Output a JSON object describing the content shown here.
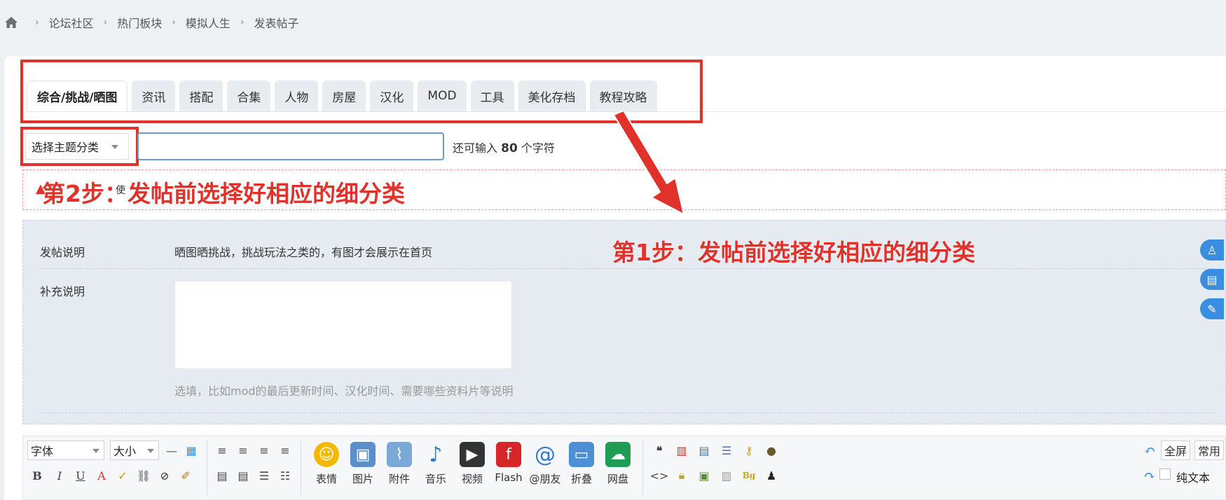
{
  "breadcrumb": {
    "items": [
      "论坛社区",
      "热门板块",
      "模拟人生",
      "发表帖子"
    ]
  },
  "tabs": [
    {
      "label": "综合/挑战/晒图",
      "active": true
    },
    {
      "label": "资讯"
    },
    {
      "label": "搭配"
    },
    {
      "label": "合集"
    },
    {
      "label": "人物"
    },
    {
      "label": "房屋"
    },
    {
      "label": "汉化"
    },
    {
      "label": "MOD"
    },
    {
      "label": "工具"
    },
    {
      "label": "美化存档"
    },
    {
      "label": "教程攻略"
    }
  ],
  "topic": {
    "type_select": "选择主题分类",
    "title_value": "",
    "char_hint_prefix": "还可输入",
    "char_count": "80",
    "char_hint_suffix": "个字符"
  },
  "notice": {
    "small_text": "使"
  },
  "annotations": {
    "step2": "第2步：发帖前选择好相应的细分类",
    "step1": "第1步：发帖前选择好相应的细分类"
  },
  "panel": {
    "post_note_label": "发帖说明",
    "post_note_text": "晒图晒挑战，挑战玩法之类的，有图才会展示在首页",
    "extra_label": "补充说明",
    "extra_hint": "选填，比如mod的最后更新时间、汉化时间、需要哪些资料片等说明"
  },
  "toolbar": {
    "font_select": "字体",
    "size_select": "大小",
    "big_buttons": [
      "表情",
      "图片",
      "附件",
      "音乐",
      "视频",
      "Flash",
      "@朋友",
      "折叠",
      "网盘"
    ],
    "fullscreen": "全屏",
    "common": "常用",
    "plain_text": "纯文本"
  },
  "colors": {
    "accent_red": "#e0322a",
    "link_blue": "#3a8ee0",
    "panel_bg": "#e5ebf1"
  }
}
